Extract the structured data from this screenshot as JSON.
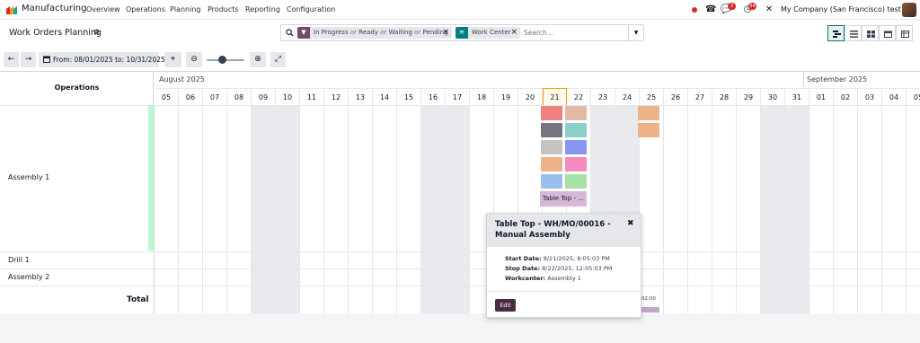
{
  "navbar": {
    "app_name": "Manufacturing",
    "menu": [
      "Overview",
      "Operations",
      "Planning",
      "Products",
      "Reporting",
      "Configuration"
    ],
    "badges": {
      "activities": "3",
      "messages": "34"
    },
    "company": "My Company (San Francisco) test te..."
  },
  "control": {
    "title": "Work Orders Planning",
    "facets": [
      {
        "parts": [
          "In Progress",
          "or",
          "Ready",
          "or",
          "Waiting",
          "or",
          "Pending"
        ],
        "color": "#714b67"
      },
      {
        "parts": [
          "Work Center"
        ],
        "color": "#017e84"
      }
    ],
    "search_placeholder": "Search..."
  },
  "toolbar": {
    "range_label": "From: 08/01/2025 to: 10/31/2025"
  },
  "gantt": {
    "ops_header": "Operations",
    "months": [
      "August 2025",
      "September 2025"
    ],
    "days": [
      "05",
      "06",
      "07",
      "08",
      "09",
      "10",
      "11",
      "12",
      "13",
      "14",
      "15",
      "16",
      "17",
      "18",
      "19",
      "20",
      "21",
      "22",
      "23",
      "24",
      "25",
      "26",
      "27",
      "28",
      "29",
      "30",
      "31",
      "01",
      "02",
      "03",
      "04",
      "05"
    ],
    "today": "21",
    "rows": [
      "Assembly 1",
      "Drill 1",
      "Assembly 2"
    ],
    "total_label": "Total",
    "block_label": "Table Top - ...",
    "total_time": "02:00",
    "block_colors": [
      "#f08080",
      "#e3b8a5",
      "#74757f",
      "#8ccfc8",
      "#c4c4c4",
      "#8796f0",
      "#ecb486",
      "#f48bbf",
      "#9bbfec",
      "#a5e0a5",
      "#ecb486",
      "#ecb486"
    ]
  },
  "popover": {
    "title": "Table Top - WH/MO/00016 - Manual Assembly",
    "start_label": "Start Date:",
    "start_value": "8/21/2025, 8:05:03 PM",
    "stop_label": "Stop Date:",
    "stop_value": "8/22/2025, 12:05:03 PM",
    "wc_label": "Workcenter:",
    "wc_value": "Assembly 1",
    "edit_label": "Edit"
  }
}
